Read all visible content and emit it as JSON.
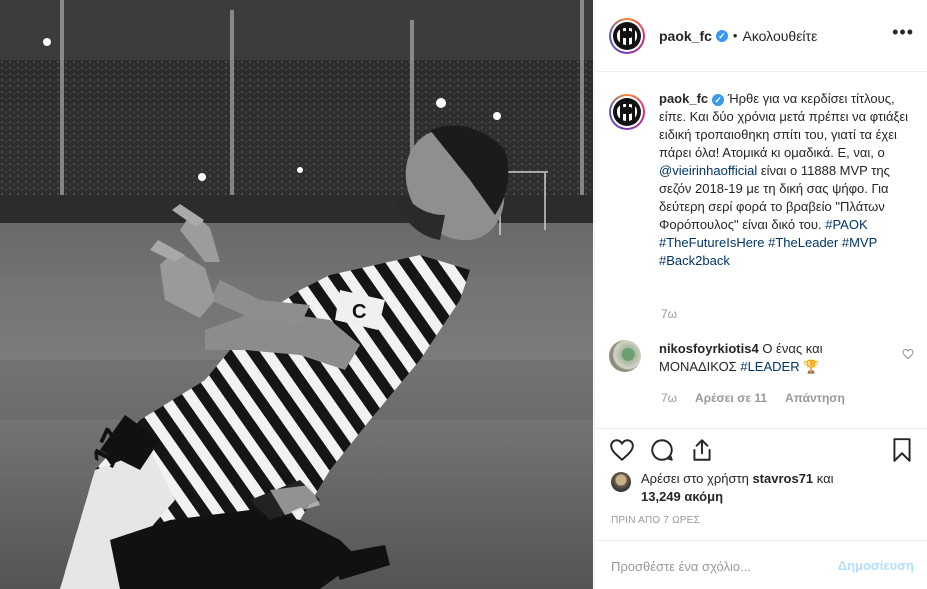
{
  "post": {
    "username": "paok_fc",
    "follow_status": "Ακολουθείτε",
    "more_icon": "more-dots-icon",
    "verified_mark": "✓"
  },
  "caption": {
    "username": "paok_fc",
    "parts": [
      "Ήρθε για να κερδίσει τίτλους, είπε. Και δύο χρόνια μετά πρέπει να φτιάξει ειδική τροπαιοθηκη σπίτι του, γιατί τα έχει πάρει όλα! Ατομικά κι ομαδικά. Ε, ναι, ο ",
      "@vieirinhaofficial",
      " είναι ο 11888 MVP της σεζόν 2018-19 με τη δική σας ψήφο. Για δεύτερη σερί φορά το βραβείο \"Πλάτων Φορόπουλος\" είναι δικό του. ",
      "#PAOK",
      " ",
      "#TheFutureIsHere",
      " ",
      "#TheLeader",
      " ",
      "#MVP",
      " ",
      "#Back2back"
    ],
    "time": "7ω"
  },
  "comment": {
    "username": "nikosfoyrkiotis4",
    "text": "Ο ένας και ΜΟΝΑΔΙΚΟΣ",
    "hashtag": "#LEADER",
    "emoji": "🏆",
    "time": "7ω",
    "likes": "Αρέσει σε 11",
    "reply": "Απάντηση",
    "like_icon": "heart-outline-icon"
  },
  "actions": {
    "like_icon": "heart-outline-icon",
    "comment_icon": "comment-bubble-icon",
    "share_icon": "share-icon",
    "save_icon": "bookmark-icon"
  },
  "likes": {
    "prefix": "Αρέσει στο χρήστη ",
    "user": "stavros71",
    "middle": " και",
    "count_text": "13,249 ακόμη"
  },
  "timestamp": "ΠΡΙΝ ΑΠΟ 7 ΩΡΕΣ",
  "add_comment": {
    "placeholder": "Προσθέστε ένα σχόλιο...",
    "post_label": "Δημοσίευση"
  },
  "colors": {
    "link": "#003569",
    "verified": "#3897f0",
    "post_button_disabled": "#b2dffc"
  }
}
